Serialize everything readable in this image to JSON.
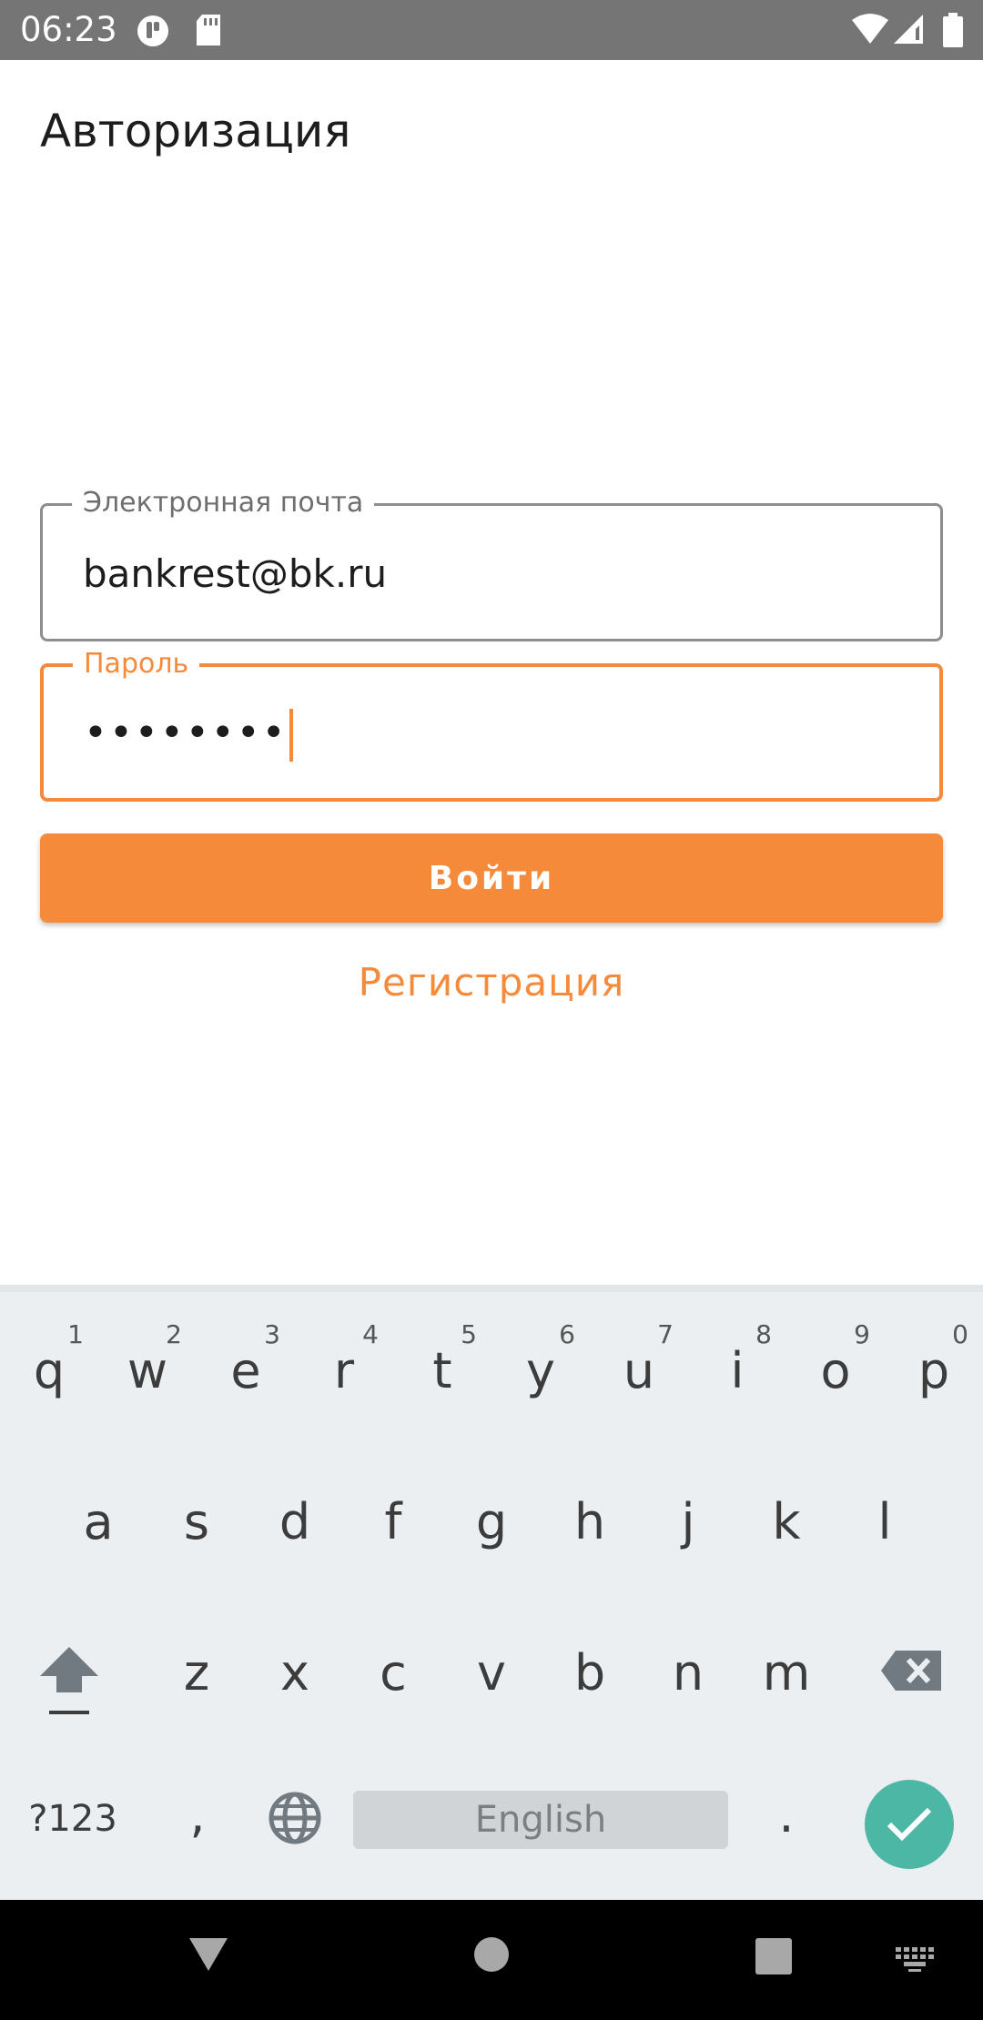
{
  "status_bar": {
    "time": "06:23",
    "icons": [
      "data-saver-icon",
      "sd-card-icon",
      "wifi-icon",
      "signal-icon",
      "battery-icon"
    ]
  },
  "header": {
    "title": "Авторизация"
  },
  "form": {
    "email": {
      "label": "Электронная почта",
      "value": "bankrest@bk.ru"
    },
    "password": {
      "label": "Пароль",
      "masked_value": "••••••••"
    },
    "login_button": "Войти",
    "register_link": "Регистрация"
  },
  "keyboard": {
    "row1": [
      {
        "key": "q",
        "hint": "1"
      },
      {
        "key": "w",
        "hint": "2"
      },
      {
        "key": "e",
        "hint": "3"
      },
      {
        "key": "r",
        "hint": "4"
      },
      {
        "key": "t",
        "hint": "5"
      },
      {
        "key": "y",
        "hint": "6"
      },
      {
        "key": "u",
        "hint": "7"
      },
      {
        "key": "i",
        "hint": "8"
      },
      {
        "key": "o",
        "hint": "9"
      },
      {
        "key": "p",
        "hint": "0"
      }
    ],
    "row2": [
      "a",
      "s",
      "d",
      "f",
      "g",
      "h",
      "j",
      "k",
      "l"
    ],
    "row3": [
      "z",
      "x",
      "c",
      "v",
      "b",
      "n",
      "m"
    ],
    "symbols_key": "?123",
    "comma_key": ",",
    "period_key": ".",
    "space_label": "English"
  },
  "colors": {
    "accent": "#f68a3b",
    "status_bar": "#757575",
    "keyboard_bg": "#eceff1",
    "done_key": "#4cb7a5"
  }
}
